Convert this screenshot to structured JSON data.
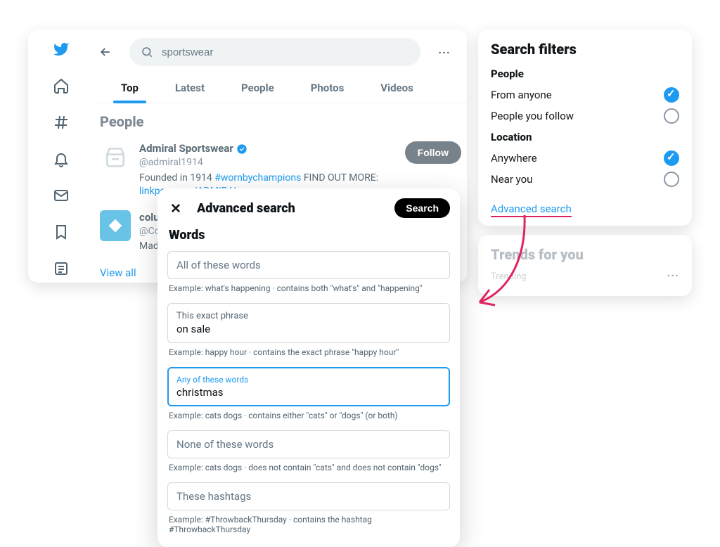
{
  "search": {
    "value": "sportswear"
  },
  "tabs": [
    "Top",
    "Latest",
    "People",
    "Photos",
    "Videos"
  ],
  "active_tab": 0,
  "people": {
    "heading": "People",
    "view_all": "View all",
    "results": [
      {
        "name": "Admiral Sportswear",
        "verified": true,
        "handle": "@admiral1914",
        "bio_pre": "Founded in 1914 ",
        "bio_hashtag": "#wornbychampions",
        "bio_mid": " FIND OUT MORE: ",
        "bio_link": "linkpop.com/ADMIRAL",
        "follow": "Follow"
      },
      {
        "name": "colum",
        "handle": "@Col",
        "bio_pre": "Made"
      }
    ]
  },
  "filters": {
    "title": "Search filters",
    "people_head": "People",
    "from_anyone": "From anyone",
    "people_you_follow": "People you follow",
    "location_head": "Location",
    "anywhere": "Anywhere",
    "near_you": "Near you",
    "advanced_link": "Advanced search"
  },
  "trends": {
    "title": "Trends for you",
    "sub": "Trending"
  },
  "modal": {
    "title": "Advanced search",
    "search_btn": "Search",
    "section": "Words",
    "fields": [
      {
        "label": "All of these words",
        "value": "",
        "hint": "Example: what's happening · contains both \"what's\" and \"happening\""
      },
      {
        "label": "This exact phrase",
        "value": "on sale",
        "hint": "Example: happy hour · contains the exact phrase \"happy hour\""
      },
      {
        "label": "Any of these words",
        "value": "christmas",
        "hint": "Example: cats dogs · contains either \"cats\" or \"dogs\" (or both)",
        "focused": true
      },
      {
        "label": "None of these words",
        "value": "",
        "hint": "Example: cats dogs · does not contain \"cats\" and does not contain \"dogs\""
      },
      {
        "label": "These hashtags",
        "value": "",
        "hint": "Example: #ThrowbackThursday · contains the hashtag #ThrowbackThursday"
      }
    ]
  }
}
